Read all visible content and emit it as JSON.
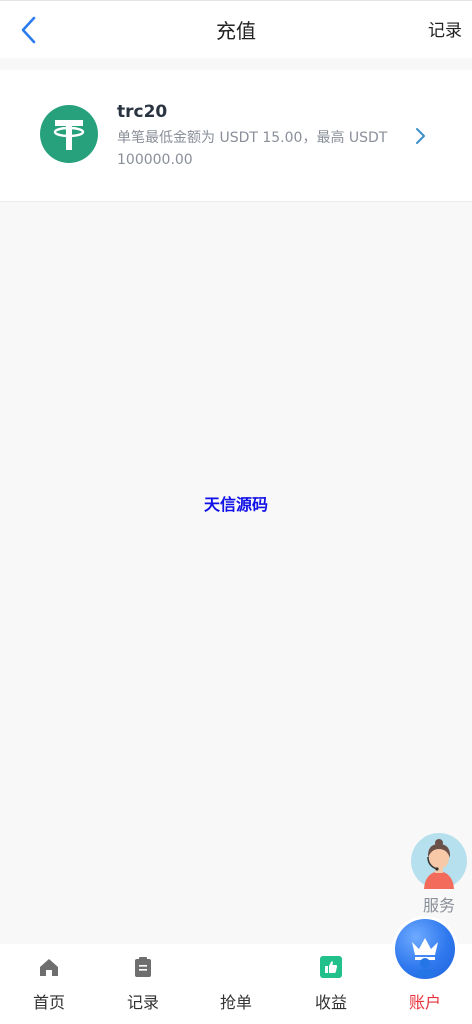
{
  "header": {
    "title": "充值",
    "right_link": "记录",
    "back_icon": "chevron-left-icon"
  },
  "payment": {
    "name": "trc20",
    "description": "单笔最低金额为 USDT 15.00，最高 USDT 100000.00",
    "logo_icon": "usdt-tether-icon",
    "logo_color": "#26a17b",
    "arrow_icon": "chevron-right-icon"
  },
  "watermark": "天信源码",
  "service": {
    "label": "服务",
    "icon": "customer-service-avatar-icon"
  },
  "tabbar": {
    "active_color": "#e8323c",
    "accent_color": "#2f78ee",
    "tabs": [
      {
        "label": "首页",
        "icon": "home-icon"
      },
      {
        "label": "记录",
        "icon": "clipboard-icon"
      },
      {
        "label": "抢单",
        "icon": "crown-icon"
      },
      {
        "label": "收益",
        "icon": "thumbs-up-icon"
      },
      {
        "label": "账户",
        "icon": "user-icon",
        "active": true
      }
    ]
  }
}
